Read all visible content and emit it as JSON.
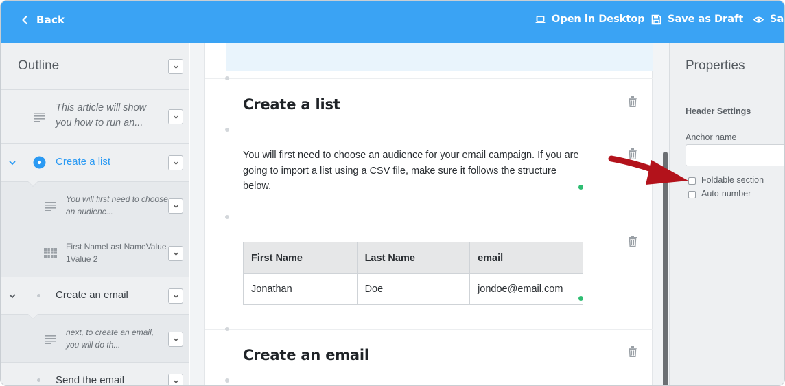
{
  "topbar": {
    "back_label": "Back",
    "actions": [
      {
        "label": "Open in Desktop",
        "icon": "laptop-icon"
      },
      {
        "label": "Save as Draft",
        "icon": "floppy-disk-icon"
      },
      {
        "label": "Sav",
        "icon": "eye-icon"
      }
    ],
    "color": "#3aa3f4"
  },
  "outline": {
    "title": "Outline",
    "items": [
      {
        "type": "paragraph",
        "text": "This article will show you how to run an...",
        "line1": "This article will show",
        "line2": "you how to run an..."
      },
      {
        "type": "header",
        "text": "Create a list",
        "active": true
      },
      {
        "type": "paragraph",
        "line1": "You will first need to choose",
        "line2": "an audienc..."
      },
      {
        "type": "table",
        "line1": "First NameLast NameValue",
        "line2": "1Value 2"
      },
      {
        "type": "header",
        "text": "Create an email"
      },
      {
        "type": "paragraph",
        "line1": "next, to create an email,",
        "line2": "you will do th..."
      },
      {
        "type": "header",
        "text": "Send the email"
      }
    ]
  },
  "editor": {
    "heading1": "Create a list",
    "paragraph": "You will first need to choose an audience for your email campaign. If you are going to import a list using a CSV file, make sure it follows the structure below.",
    "table": {
      "headers": [
        "First Name",
        "Last Name",
        "email"
      ],
      "rows": [
        [
          "Jonathan",
          "Doe",
          "jondoe@email.com"
        ]
      ]
    },
    "heading2": "Create an email"
  },
  "properties": {
    "title": "Properties",
    "section": "Header Settings",
    "anchor_label": "Anchor name",
    "anchor_value": "",
    "options": [
      {
        "label": "Foldable section",
        "checked": false
      },
      {
        "label": "Auto-number",
        "checked": false
      }
    ]
  },
  "colors": {
    "accent": "#2b9af3",
    "annotation_arrow": "#b3121b",
    "status_dot": "#2ebd72"
  }
}
